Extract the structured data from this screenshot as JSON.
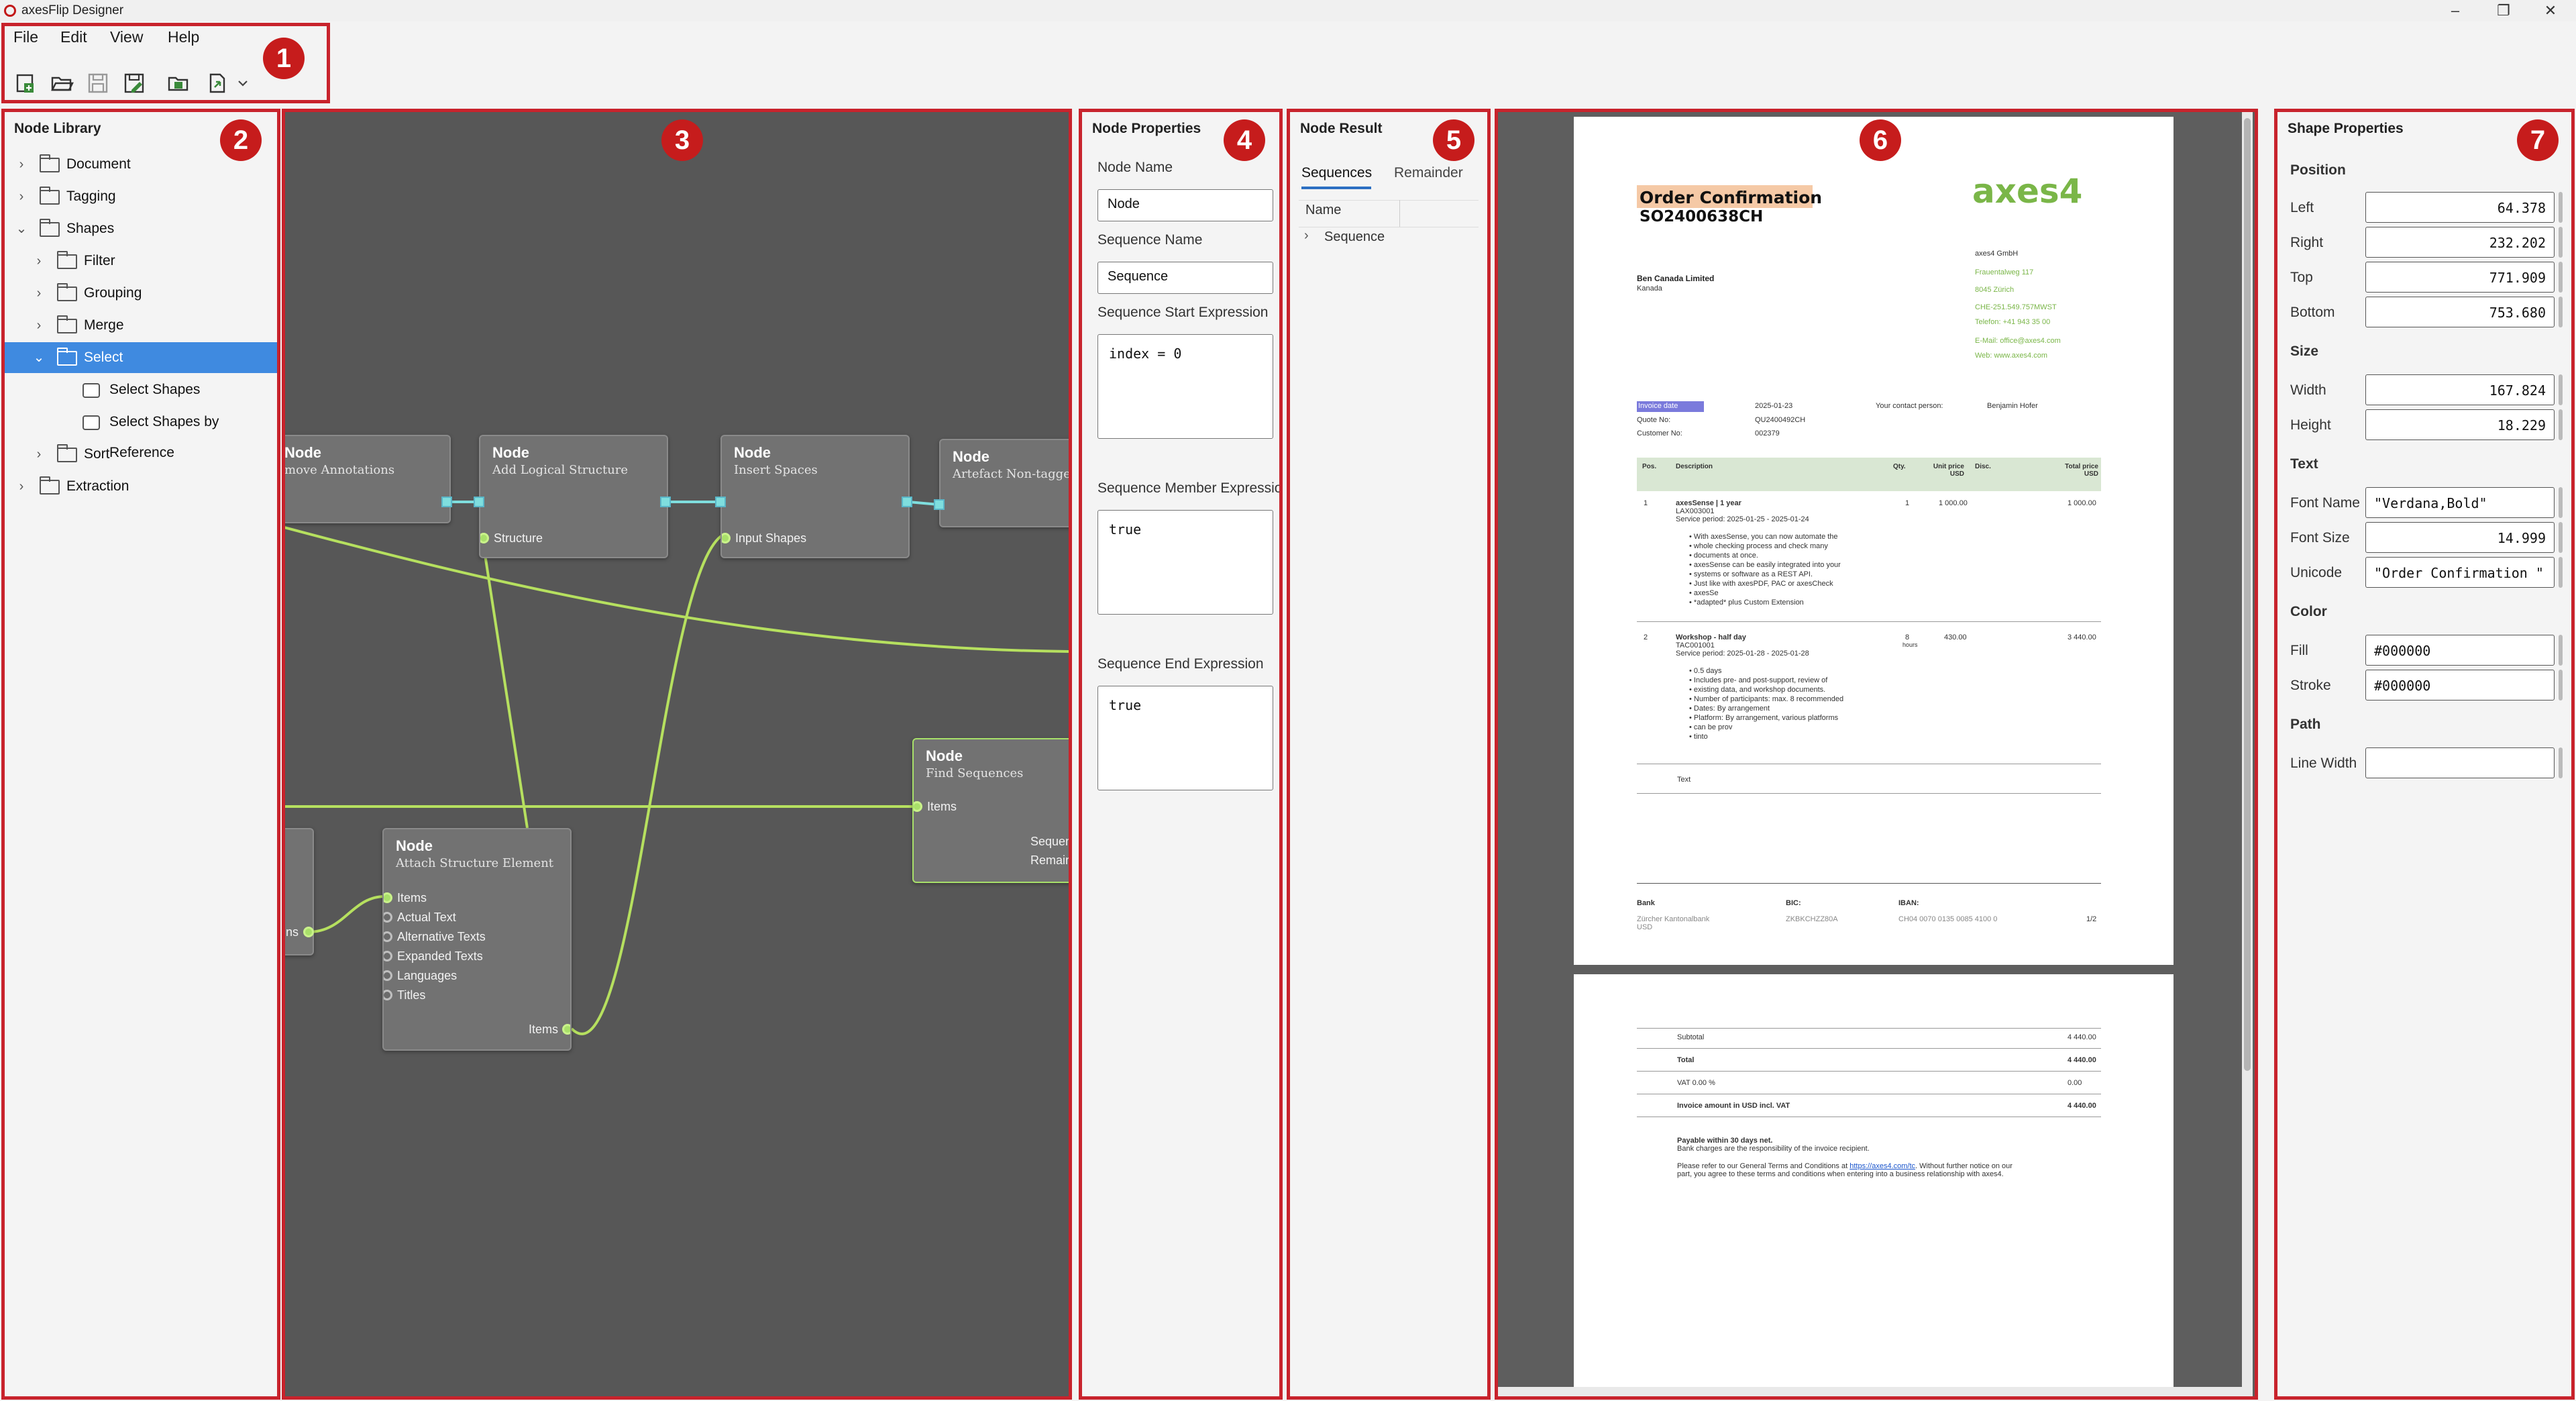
{
  "app": {
    "title": "axesFlip Designer",
    "min": "–",
    "max": "❐",
    "close": "✕"
  },
  "menu": [
    "File",
    "Edit",
    "View",
    "Help"
  ],
  "toolbar": {
    "icons": [
      "new-document-icon",
      "open-icon",
      "save-icon",
      "save-as-icon",
      "open-folder-icon",
      "export-icon"
    ]
  },
  "callouts": [
    "1",
    "2",
    "3",
    "4",
    "5",
    "6",
    "7"
  ],
  "library": {
    "title": "Node Library",
    "items": [
      {
        "label": "Document",
        "level": 0,
        "type": "folder",
        "expanded": false
      },
      {
        "label": "Tagging",
        "level": 0,
        "type": "folder",
        "expanded": false
      },
      {
        "label": "Shapes",
        "level": 0,
        "type": "folder",
        "expanded": true
      },
      {
        "label": "Filter",
        "level": 1,
        "type": "folder",
        "expanded": false
      },
      {
        "label": "Grouping",
        "level": 1,
        "type": "folder",
        "expanded": false
      },
      {
        "label": "Merge",
        "level": 1,
        "type": "folder",
        "expanded": false
      },
      {
        "label": "Select",
        "level": 1,
        "type": "folder",
        "expanded": true,
        "selected": true
      },
      {
        "label": "Select Shapes",
        "level": 2,
        "type": "shape"
      },
      {
        "label": "Select Shapes by Reference",
        "level": 2,
        "type": "shape"
      },
      {
        "label": "Sort",
        "level": 1,
        "type": "folder",
        "expanded": false
      },
      {
        "label": "Extraction",
        "level": 0,
        "type": "folder",
        "expanded": false
      }
    ]
  },
  "graph": {
    "nodes": [
      {
        "title": "Node",
        "sub": "move Annotations"
      },
      {
        "title": "Node",
        "sub": "Add Logical Structure",
        "ports": [
          "Structure"
        ]
      },
      {
        "title": "Node",
        "sub": "Insert Spaces",
        "ports": [
          "Input Shapes"
        ]
      },
      {
        "title": "Node",
        "sub": "Artefact Non-tagged C"
      },
      {
        "title": "Node",
        "sub": "Find Sequences",
        "ports": [
          "Items",
          "Sequen",
          "Remaind"
        ]
      },
      {
        "title": "Node",
        "sub": "Attach Structure Element",
        "ports": [
          "Items",
          "Actual Text",
          "Alternative Texts",
          "Expanded Texts",
          "Languages",
          "Titles",
          "Items"
        ]
      },
      {
        "title": "",
        "sub": "",
        "ports": [
          "ns"
        ]
      }
    ]
  },
  "props": {
    "title": "Node Properties",
    "node_name_label": "Node Name",
    "node_name": "Node",
    "seq_name_label": "Sequence Name",
    "seq_name": "Sequence",
    "seq_start_label": "Sequence Start Expression",
    "seq_start": "index = 0",
    "seq_member_label": "Sequence Member Expressio",
    "seq_member": "true",
    "seq_end_label": "Sequence End Expression",
    "seq_end": "true"
  },
  "result": {
    "title": "Node Result",
    "tabs": [
      "Sequences",
      "Remainder"
    ],
    "col_name": "Name",
    "rows": [
      "Sequence"
    ]
  },
  "doc": {
    "p1": {
      "title": "Order Confirmation",
      "number": "SO2400638CH",
      "logo": "axes4",
      "customer": "Ben Canada Limited",
      "country": "Kanada",
      "company_addr": [
        "axes4 GmbH",
        "Frauentalweg 117",
        "8045 Zürich",
        "CHE-251.549.757MWST",
        "Telefon: +41 943 35 00",
        "E-Mail: office@axes4.com",
        "Web: www.axes4.com"
      ],
      "info_left": [
        "Invoice date",
        "Quote No:",
        "Customer No:"
      ],
      "info_vals": [
        "2025-01-23",
        "QU2400492CH",
        "002379"
      ],
      "contact_label": "Your contact person:",
      "contact": "Benjamin Hofer",
      "headers": [
        "Pos.",
        "Description",
        "Qty.",
        "Unit price USD",
        "Disc.",
        "Total price USD"
      ],
      "row1": {
        "pos": "1",
        "desc": "axesSense | 1 year",
        "code": "LAX003001",
        "period": "Service period: 2025-01-25 - 2025-01-24",
        "qty": "1",
        "unit": "1 000.00",
        "total": "1 000.00",
        "bullets": [
          "With axesSense, you can now automate the",
          "whole checking process and check many",
          "documents at once.",
          "axesSense can be easily integrated into your",
          "systems or software as a REST API.",
          "Just like with axesPDF, PAC or axesCheck",
          "axesSe",
          "*adapted* plus Custom Extension"
        ]
      },
      "row2": {
        "pos": "2",
        "desc": "Workshop - half day",
        "code": "TAC001001",
        "period": "Service period: 2025-01-28 - 2025-01-28",
        "qty": "8",
        "unit_label": "hours",
        "unit": "430.00",
        "total": "3 440.00",
        "bullets": [
          "0.5 days",
          "Includes pre- and post-support, review of",
          "existing data, and workshop documents.",
          "Number of participants: max. 8 recommended",
          "Dates: By arrangement",
          "Platform: By arrangement, various platforms",
          "can be prov",
          "tinto"
        ]
      },
      "text_row": "Text",
      "footer": {
        "bank_label": "Bank",
        "bank": "Zürcher Kantonalbank",
        "bank2": "USD",
        "bic_label": "BIC:",
        "bic": "ZKBKCHZZ80A",
        "iban_label": "IBAN:",
        "iban": "CH04 0070 0135 0085 4100 0",
        "page": "1/2"
      }
    },
    "p2": {
      "rows": [
        {
          "label": "Subtotal",
          "value": "4 440.00",
          "bold": false
        },
        {
          "label": "Total",
          "value": "4 440.00",
          "bold": true
        },
        {
          "label": "VAT  0.00 %",
          "value": "0.00",
          "bold": false
        },
        {
          "label": "Invoice amount in USD incl. VAT",
          "value": "4 440.00",
          "bold": true
        }
      ],
      "payable": "Payable within 30 days net.",
      "bank_charges": "Bank charges are the responsibility of the invoice recipient.",
      "terms1": "Please refer to our General Terms and Conditions at",
      "terms_link": "https://axes4.com/tc",
      "terms2": ". Without further notice on our",
      "terms3": "part, you agree to these terms and conditions when entering into a business relationship with axes4."
    }
  },
  "shape_props": {
    "title": "Shape Properties",
    "position_label": "Position",
    "left_label": "Left",
    "left": "64.378",
    "right_label": "Right",
    "right": "232.202",
    "top_label": "Top",
    "top": "771.909",
    "bottom_label": "Bottom",
    "bottom": "753.680",
    "size_label": "Size",
    "width_label": "Width",
    "width": "167.824",
    "height_label": "Height",
    "height": "18.229",
    "text_label": "Text",
    "font_name_label": "Font Name",
    "font_name": "\"Verdana,Bold\"",
    "font_size_label": "Font Size",
    "font_size": "14.999",
    "unicode_label": "Unicode",
    "unicode": "\"Order Confirmation \"",
    "color_label": "Color",
    "fill_label": "Fill",
    "fill": "#000000",
    "stroke_label": "Stroke",
    "stroke": "#000000",
    "path_label": "Path",
    "line_width_label": "Line Width",
    "line_width": ""
  },
  "colors": {
    "callout": "#c61c1c",
    "highlight": "#f5c9a6",
    "selection": "#3f8ae0",
    "wire": "#b6e05f",
    "logo": "#7ab648"
  }
}
